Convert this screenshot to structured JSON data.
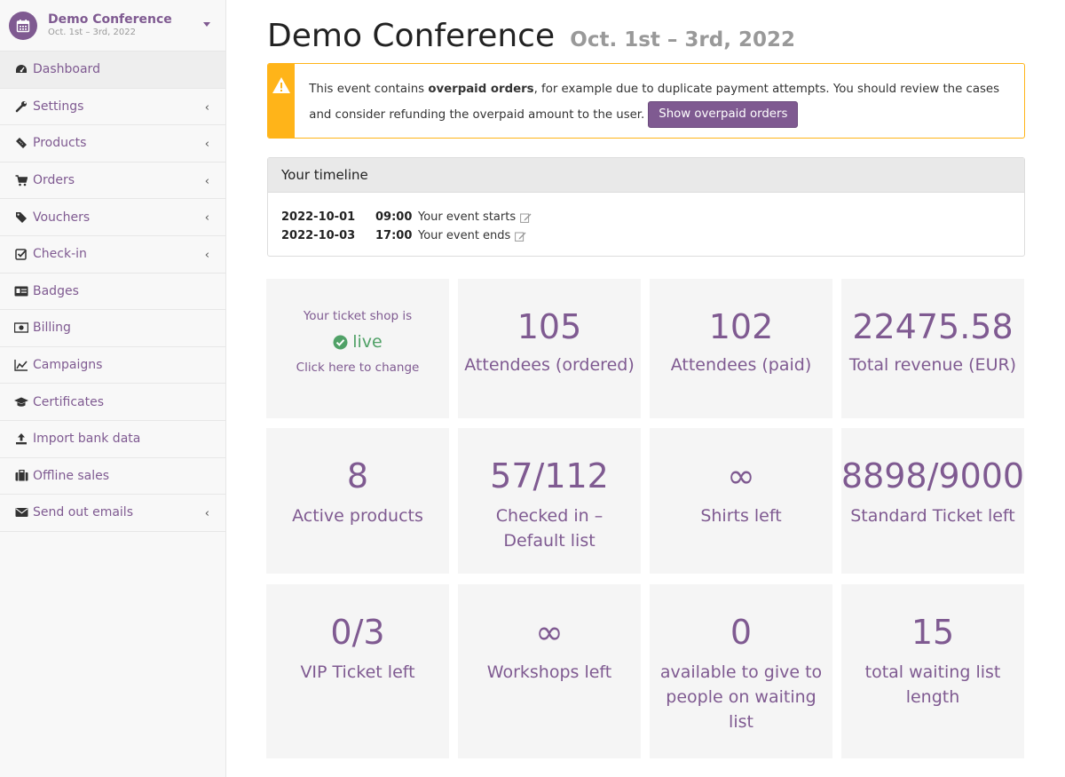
{
  "sidebar": {
    "event_name": "Demo Conference",
    "event_dates": "Oct. 1st – 3rd, 2022",
    "items": [
      {
        "label": "Dashboard",
        "icon": "dashboard-icon",
        "active": true,
        "submenu": false
      },
      {
        "label": "Settings",
        "icon": "wrench-icon",
        "active": false,
        "submenu": true
      },
      {
        "label": "Products",
        "icon": "ticket-icon",
        "active": false,
        "submenu": true
      },
      {
        "label": "Orders",
        "icon": "cart-icon",
        "active": false,
        "submenu": true
      },
      {
        "label": "Vouchers",
        "icon": "tags-icon",
        "active": false,
        "submenu": true
      },
      {
        "label": "Check-in",
        "icon": "checkbox-icon",
        "active": false,
        "submenu": true
      },
      {
        "label": "Badges",
        "icon": "id-card-icon",
        "active": false,
        "submenu": false
      },
      {
        "label": "Billing",
        "icon": "money-icon",
        "active": false,
        "submenu": false
      },
      {
        "label": "Campaigns",
        "icon": "line-chart-icon",
        "active": false,
        "submenu": false
      },
      {
        "label": "Certificates",
        "icon": "graduation-cap-icon",
        "active": false,
        "submenu": false
      },
      {
        "label": "Import bank data",
        "icon": "upload-icon",
        "active": false,
        "submenu": false
      },
      {
        "label": "Offline sales",
        "icon": "briefcase-icon",
        "active": false,
        "submenu": false
      },
      {
        "label": "Send out emails",
        "icon": "envelope-icon",
        "active": false,
        "submenu": true
      }
    ]
  },
  "header": {
    "title": "Demo Conference",
    "subtitle": "Oct. 1st – 3rd, 2022"
  },
  "alert": {
    "text_before": "This event contains ",
    "text_bold": "overpaid orders",
    "text_after": ", for example due to duplicate payment attempts. You should review the cases and consider refunding the overpaid amount to the user.",
    "button_label": "Show overpaid orders"
  },
  "timeline": {
    "title": "Your timeline",
    "rows": [
      {
        "date": "2022-10-01",
        "time": "09:00",
        "text": "Your event starts"
      },
      {
        "date": "2022-10-03",
        "time": "17:00",
        "text": "Your event ends"
      }
    ]
  },
  "shop_status": {
    "line1": "Your ticket shop is",
    "status": "live",
    "line3": "Click here to change"
  },
  "tiles": [
    {
      "value": "105",
      "label": "Attendees (ordered)"
    },
    {
      "value": "102",
      "label": "Attendees (paid)"
    },
    {
      "value": "22475.58",
      "label": "Total revenue (EUR)"
    },
    {
      "value": "8",
      "label": "Active products"
    },
    {
      "value": "57/112",
      "label": "Checked in – Default list"
    },
    {
      "value": "∞",
      "label": "Shirts left"
    },
    {
      "value": "8898/9000",
      "label": "Standard Ticket left"
    },
    {
      "value": "0/3",
      "label": "VIP Ticket left"
    },
    {
      "value": "∞",
      "label": "Workshops left"
    },
    {
      "value": "0",
      "label": "available to give to people on waiting list"
    },
    {
      "value": "15",
      "label": "total waiting list length"
    }
  ],
  "colors": {
    "brand": "#7f5a91",
    "warning": "#ffb419",
    "success": "#50a167",
    "tile_bg": "#f5f5f5"
  }
}
